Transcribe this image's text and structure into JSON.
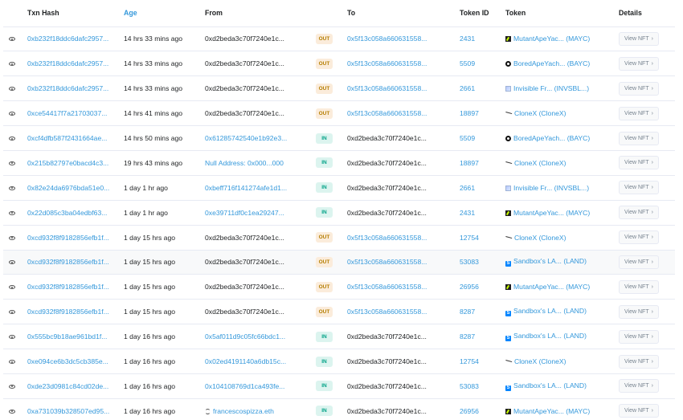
{
  "header": {
    "txn_hash": "Txn Hash",
    "age": "Age",
    "from": "From",
    "to": "To",
    "token_id": "Token ID",
    "token": "Token",
    "details": "Details"
  },
  "view_nft_label": "View NFT",
  "rows": [
    {
      "hash": "0xb232f18ddc6dafc2957...",
      "age": "14 hrs 33 mins ago",
      "from": "0xd2beda3c70f7240e1c...",
      "from_link": false,
      "dir": "OUT",
      "to": "0x5f13c058a660631558...",
      "to_link": true,
      "token_id": "2431",
      "icon": "mayc",
      "token": "MutantApeYac... (MAYC)"
    },
    {
      "hash": "0xb232f18ddc6dafc2957...",
      "age": "14 hrs 33 mins ago",
      "from": "0xd2beda3c70f7240e1c...",
      "from_link": false,
      "dir": "OUT",
      "to": "0x5f13c058a660631558...",
      "to_link": true,
      "token_id": "5509",
      "icon": "bayc",
      "token": "BoredApeYach... (BAYC)"
    },
    {
      "hash": "0xb232f18ddc6dafc2957...",
      "age": "14 hrs 33 mins ago",
      "from": "0xd2beda3c70f7240e1c...",
      "from_link": false,
      "dir": "OUT",
      "to": "0x5f13c058a660631558...",
      "to_link": true,
      "token_id": "2661",
      "icon": "inv",
      "token": "Invisible Fr... (INVSBL...)"
    },
    {
      "hash": "0xce54417f7a21703037...",
      "age": "14 hrs 41 mins ago",
      "from": "0xd2beda3c70f7240e1c...",
      "from_link": false,
      "dir": "OUT",
      "to": "0x5f13c058a660631558...",
      "to_link": true,
      "token_id": "18897",
      "icon": "clonex",
      "token": "CloneX (CloneX)"
    },
    {
      "hash": "0xcf4dfb587f2431664ae...",
      "age": "14 hrs 50 mins ago",
      "from": "0x61285742540e1b92e3...",
      "from_link": true,
      "dir": "IN",
      "to": "0xd2beda3c70f7240e1c...",
      "to_link": false,
      "token_id": "5509",
      "icon": "bayc",
      "token": "BoredApeYach... (BAYC)"
    },
    {
      "hash": "0x215b82797e0bacd4c3...",
      "age": "19 hrs 43 mins ago",
      "from": "Null Address: 0x000...000",
      "from_link": true,
      "dir": "IN",
      "to": "0xd2beda3c70f7240e1c...",
      "to_link": false,
      "token_id": "18897",
      "icon": "clonex",
      "token": "CloneX (CloneX)"
    },
    {
      "hash": "0x82e24da6976bda51e0...",
      "age": "1 day 1 hr ago",
      "from": "0xbeff716f141274afe1d1...",
      "from_link": true,
      "dir": "IN",
      "to": "0xd2beda3c70f7240e1c...",
      "to_link": false,
      "token_id": "2661",
      "icon": "inv",
      "token": "Invisible Fr... (INVSBL...)"
    },
    {
      "hash": "0x22d085c3ba04edbf63...",
      "age": "1 day 1 hr ago",
      "from": "0xe39711df0c1ea29247...",
      "from_link": true,
      "dir": "IN",
      "to": "0xd2beda3c70f7240e1c...",
      "to_link": false,
      "token_id": "2431",
      "icon": "mayc",
      "token": "MutantApeYac... (MAYC)"
    },
    {
      "hash": "0xcd932f8f9182856efb1f...",
      "age": "1 day 15 hrs ago",
      "from": "0xd2beda3c70f7240e1c...",
      "from_link": false,
      "dir": "OUT",
      "to": "0x5f13c058a660631558...",
      "to_link": true,
      "token_id": "12754",
      "icon": "clonex",
      "token": "CloneX (CloneX)"
    },
    {
      "hash": "0xcd932f8f9182856efb1f...",
      "age": "1 day 15 hrs ago",
      "from": "0xd2beda3c70f7240e1c...",
      "from_link": false,
      "dir": "OUT",
      "to": "0x5f13c058a660631558...",
      "to_link": true,
      "token_id": "53083",
      "icon": "sand",
      "token": "Sandbox's LA... (LAND)"
    },
    {
      "hash": "0xcd932f8f9182856efb1f...",
      "age": "1 day 15 hrs ago",
      "from": "0xd2beda3c70f7240e1c...",
      "from_link": false,
      "dir": "OUT",
      "to": "0x5f13c058a660631558...",
      "to_link": true,
      "token_id": "26956",
      "icon": "mayc",
      "token": "MutantApeYac... (MAYC)"
    },
    {
      "hash": "0xcd932f8f9182856efb1f...",
      "age": "1 day 15 hrs ago",
      "from": "0xd2beda3c70f7240e1c...",
      "from_link": false,
      "dir": "OUT",
      "to": "0x5f13c058a660631558...",
      "to_link": true,
      "token_id": "8287",
      "icon": "sand",
      "token": "Sandbox's LA... (LAND)"
    },
    {
      "hash": "0x555bc9b18ae961bd1f...",
      "age": "1 day 16 hrs ago",
      "from": "0x5af011d9c05fc66bdc1...",
      "from_link": true,
      "dir": "IN",
      "to": "0xd2beda3c70f7240e1c...",
      "to_link": false,
      "token_id": "8287",
      "icon": "sand",
      "token": "Sandbox's LA... (LAND)"
    },
    {
      "hash": "0xe094ce6b3dc5cb385e...",
      "age": "1 day 16 hrs ago",
      "from": "0x02ed4191140a6db15c...",
      "from_link": true,
      "dir": "IN",
      "to": "0xd2beda3c70f7240e1c...",
      "to_link": false,
      "token_id": "12754",
      "icon": "clonex",
      "token": "CloneX (CloneX)"
    },
    {
      "hash": "0xde23d0981c84cd02de...",
      "age": "1 day 16 hrs ago",
      "from": "0x104108769d1ca493fe...",
      "from_link": true,
      "dir": "IN",
      "to": "0xd2beda3c70f7240e1c...",
      "to_link": false,
      "token_id": "53083",
      "icon": "sand",
      "token": "Sandbox's LA... (LAND)"
    },
    {
      "hash": "0xa731039b328507ed95...",
      "age": "1 day 16 hrs ago",
      "from": "francescospizza.eth",
      "from_link": true,
      "from_ens": true,
      "dir": "IN",
      "to": "0xd2beda3c70f7240e1c...",
      "to_link": false,
      "token_id": "26956",
      "icon": "mayc",
      "token": "MutantApeYac... (MAYC)"
    }
  ]
}
